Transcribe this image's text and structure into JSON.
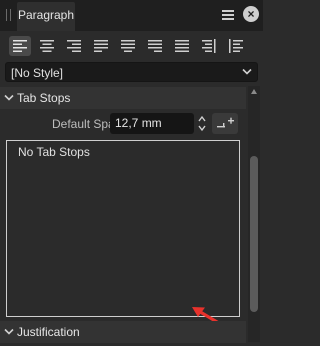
{
  "panel": {
    "tab_label": "Paragraph",
    "menu_icon": "hamburger-icon",
    "close_icon": "close-icon"
  },
  "alignment": {
    "buttons": [
      {
        "name": "align-left",
        "active": true
      },
      {
        "name": "align-center"
      },
      {
        "name": "align-right"
      },
      {
        "name": "justify-left"
      },
      {
        "name": "justify-center"
      },
      {
        "name": "justify-right"
      },
      {
        "name": "justify-all"
      },
      {
        "name": "align-towards-spine"
      },
      {
        "name": "align-away-from-spine"
      }
    ]
  },
  "style_select": {
    "value": "[No Style]"
  },
  "tab_stops": {
    "header": "Tab Stops",
    "default_spacing_label": "Default Spacing:",
    "default_spacing_value": "12,7 mm",
    "empty_text": "No Tab Stops"
  },
  "justification": {
    "header": "Justification"
  },
  "colors": {
    "panel_bg": "#2b2b2b",
    "titlebar_bg": "#1f1f1f",
    "input_bg": "#151515",
    "annotation_arrow": "#e8322c"
  }
}
